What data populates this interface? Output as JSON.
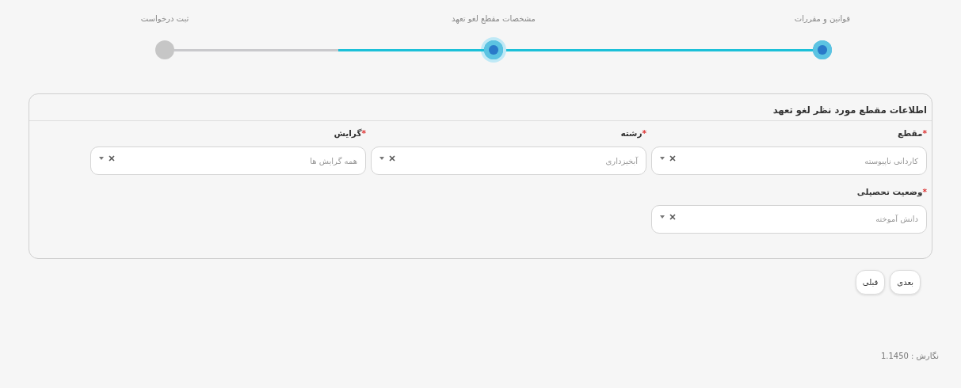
{
  "stepper": {
    "steps": [
      {
        "label": "قوانین و مقررات",
        "completed": true,
        "selected": false
      },
      {
        "label": "مشخصات مقطع لغو تعهد",
        "completed": false,
        "selected": true
      },
      {
        "label": "ثبت درخواست",
        "completed": false,
        "selected": false
      }
    ],
    "connectors": [
      {
        "level": 1
      },
      {
        "level": 0.47
      }
    ]
  },
  "card": {
    "title": "اطلاعات مقطع مورد نظر لغو تعهد",
    "fields": [
      {
        "required_mark": "*",
        "label": "مقطع",
        "value": "کاردانی ناپیوسته"
      },
      {
        "required_mark": "*",
        "label": "رشته",
        "value": "آبخیزداری"
      },
      {
        "required_mark": "*",
        "label": "گرایش",
        "value": "همه گرایش ها"
      },
      {
        "required_mark": "*",
        "label": "وضعیت تحصیلی",
        "value": "دانش آموخته"
      }
    ]
  },
  "buttons": [
    "بعدی",
    "قبلی"
  ],
  "version": "نگارش : 1.1450"
}
